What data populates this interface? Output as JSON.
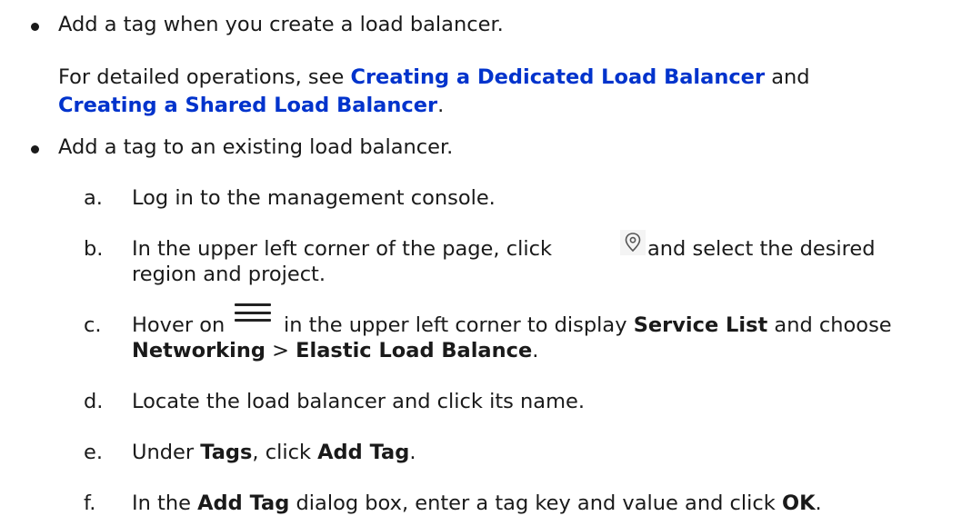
{
  "bullet1": {
    "text": "Add a tag when you create a load balancer.",
    "detail_prefix": "For detailed operations, see ",
    "link1": "Creating a Dedicated Load Balancer",
    "between": " and",
    "link2": "Creating a Shared Load Balancer",
    "end": "."
  },
  "bullet2": {
    "text": "Add a tag to an existing load balancer."
  },
  "steps": {
    "a": {
      "marker": "a.",
      "text": "Log in to the management console."
    },
    "b": {
      "marker": "b.",
      "before": "In the upper left corner of the page, click ",
      "icon": "location-pin-icon",
      "after": " and select the desired",
      "line2": "region and project."
    },
    "c": {
      "marker": "c.",
      "before": "Hover on ",
      "icon": "menu-icon",
      "mid": " in the upper left corner to display ",
      "bold1": "Service List",
      "after": " and choose",
      "bold2": "Networking",
      "sep": " > ",
      "bold3": "Elastic Load Balance",
      "end": "."
    },
    "d": {
      "marker": "d.",
      "text": "Locate the load balancer and click its name."
    },
    "e": {
      "marker": "e.",
      "before": "Under ",
      "bold1": "Tags",
      "mid": ", click ",
      "bold2": "Add Tag",
      "end": "."
    },
    "f": {
      "marker": "f.",
      "before": "In the ",
      "bold1": "Add Tag",
      "mid": " dialog box, enter a tag key and value and click ",
      "bold2": "OK",
      "end": "."
    }
  }
}
